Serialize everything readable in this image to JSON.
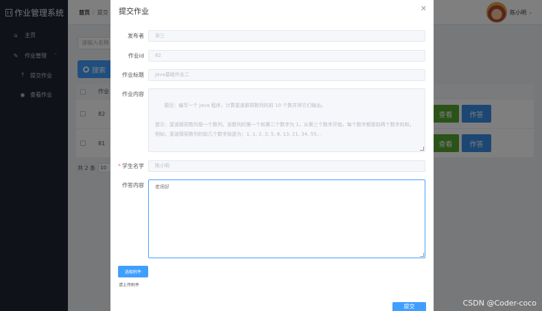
{
  "app": {
    "title": "作业管理系统"
  },
  "sidebar": {
    "items": [
      {
        "label": "主页",
        "icon": "home-icon"
      },
      {
        "label": "作业管理",
        "icon": "edit-icon",
        "children": [
          {
            "label": "提交作业",
            "icon": "upload-icon"
          },
          {
            "label": "查看作业",
            "icon": "eye-icon"
          }
        ]
      }
    ]
  },
  "header": {
    "breadcrumb": [
      "首页",
      "提交"
    ],
    "user": "陈小明"
  },
  "list": {
    "search_placeholder": "请输入名称",
    "search_button": "搜索",
    "column_header": "作业",
    "rows": [
      {
        "id": "82",
        "view_label": "查看",
        "answer_label": "作答"
      },
      {
        "id": "81",
        "view_label": "查看",
        "answer_label": "作答"
      }
    ],
    "pager_total": "共 2 条",
    "pager_size": "10"
  },
  "modal": {
    "title": "提交作业",
    "fields": {
      "publisher_label": "发布者",
      "publisher_value": "张三",
      "id_label": "作业id",
      "id_value": "82",
      "title_label": "作业标题",
      "title_value": "Java基础作业二",
      "content_label": "作业内容",
      "content_value": "题目：编写一个 Java 程序，计算斐波那契数列的前 10 个数并将它们输出。\n\n提示：斐波那契数列是一个数列，该数列的第一个和第二个数字为 1，从第三个数字开始，每个数字都是前两个数字的和。例如，斐波那契数列的前几个数字就是为：1, 1, 2, 3, 5, 8, 13, 21, 34, 55...",
      "student_label": "学生名字",
      "student_value": "陈小明",
      "answer_label": "作答内容",
      "answer_value": "老师好"
    },
    "upload_button": "选取附件",
    "upload_tip": "请上传附件",
    "submit_button": "提交"
  },
  "watermark": "CSDN @Coder-coco"
}
